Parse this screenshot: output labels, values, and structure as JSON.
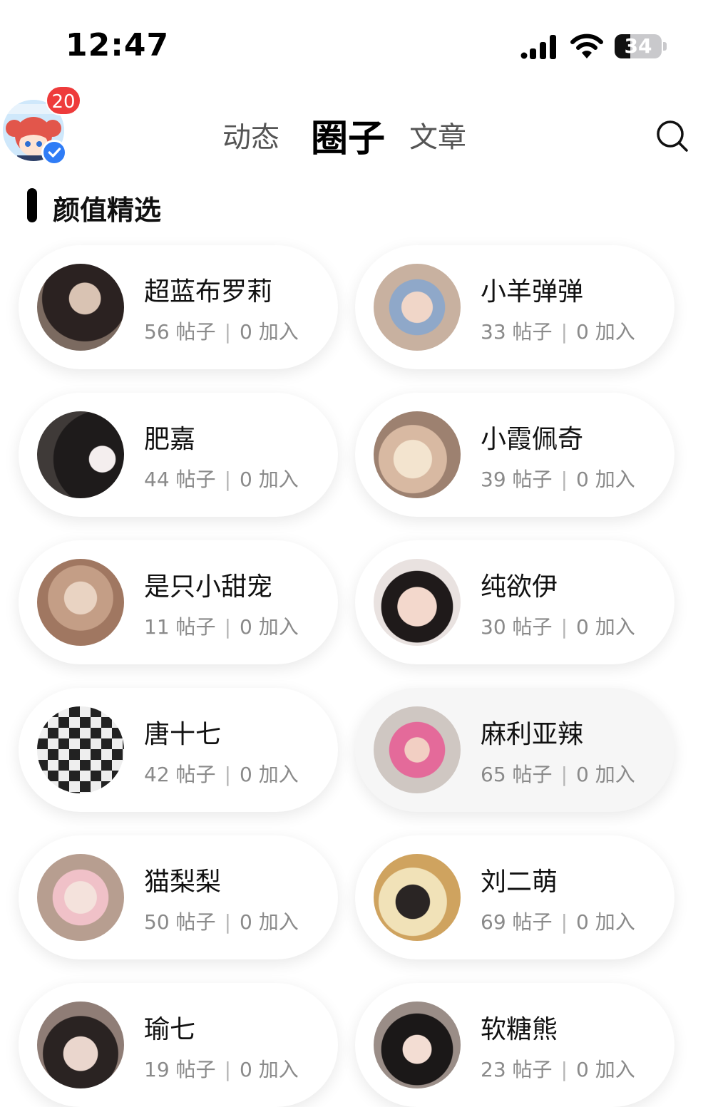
{
  "status_bar": {
    "time": "12:47",
    "battery": "34",
    "battery_level": 0.34
  },
  "header": {
    "notification_count": "20",
    "tabs": [
      {
        "label": "动态",
        "active": false
      },
      {
        "label": "圈子",
        "active": true
      },
      {
        "label": "文章",
        "active": false
      }
    ],
    "search_icon": "search-icon"
  },
  "section": {
    "title": "颜值精选"
  },
  "stats_labels": {
    "posts": "帖子",
    "join": "加入",
    "separator": "|"
  },
  "circles": [
    {
      "name": "超蓝布罗莉",
      "posts": "56",
      "joins": "0"
    },
    {
      "name": "小羊弹弹",
      "posts": "33",
      "joins": "0"
    },
    {
      "name": "肥嘉",
      "posts": "44",
      "joins": "0"
    },
    {
      "name": "小霞佩奇",
      "posts": "39",
      "joins": "0"
    },
    {
      "name": "是只小甜宠",
      "posts": "11",
      "joins": "0"
    },
    {
      "name": "纯欲伊",
      "posts": "30",
      "joins": "0"
    },
    {
      "name": "唐十七",
      "posts": "42",
      "joins": "0"
    },
    {
      "name": "麻利亚辣",
      "posts": "65",
      "joins": "0"
    },
    {
      "name": "猫梨梨",
      "posts": "50",
      "joins": "0"
    },
    {
      "name": "刘二萌",
      "posts": "69",
      "joins": "0"
    },
    {
      "name": "瑜七",
      "posts": "19",
      "joins": "0"
    },
    {
      "name": "软糖熊",
      "posts": "23",
      "joins": "0"
    }
  ]
}
